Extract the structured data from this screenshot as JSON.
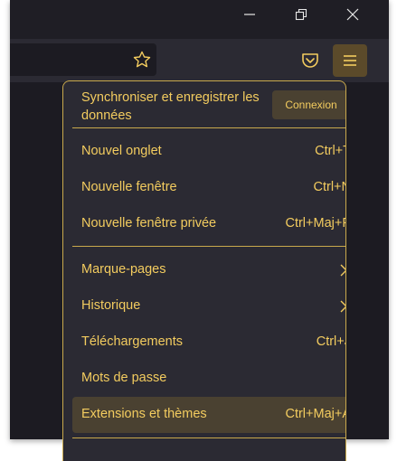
{
  "window_controls": {
    "minimize": "minimize-icon",
    "restore": "restore-icon",
    "close": "close-icon"
  },
  "toolbar": {
    "bookmark_star": "star-icon",
    "pocket": "pocket-icon",
    "menu": "hamburger-menu-icon"
  },
  "menu": {
    "sync_title": "Synchroniser et enregistrer les données",
    "connexion_label": "Connexion",
    "items": [
      {
        "label": "Nouvel onglet",
        "shortcut": "Ctrl+T"
      },
      {
        "label": "Nouvelle fenêtre",
        "shortcut": "Ctrl+N"
      },
      {
        "label": "Nouvelle fenêtre privée",
        "shortcut": "Ctrl+Maj+P"
      },
      {
        "label": "Marque-pages",
        "shortcut": ""
      },
      {
        "label": "Historique",
        "shortcut": ""
      },
      {
        "label": "Téléchargements",
        "shortcut": "Ctrl+J"
      },
      {
        "label": "Mots de passe",
        "shortcut": ""
      },
      {
        "label": "Extensions et thèmes",
        "shortcut": "Ctrl+Maj+A"
      }
    ]
  },
  "colors": {
    "accent": "#f3cc5f",
    "panel_bg": "#2b2a33",
    "highlight_bg": "#4a4131",
    "window_bg": "#1c1b22"
  }
}
